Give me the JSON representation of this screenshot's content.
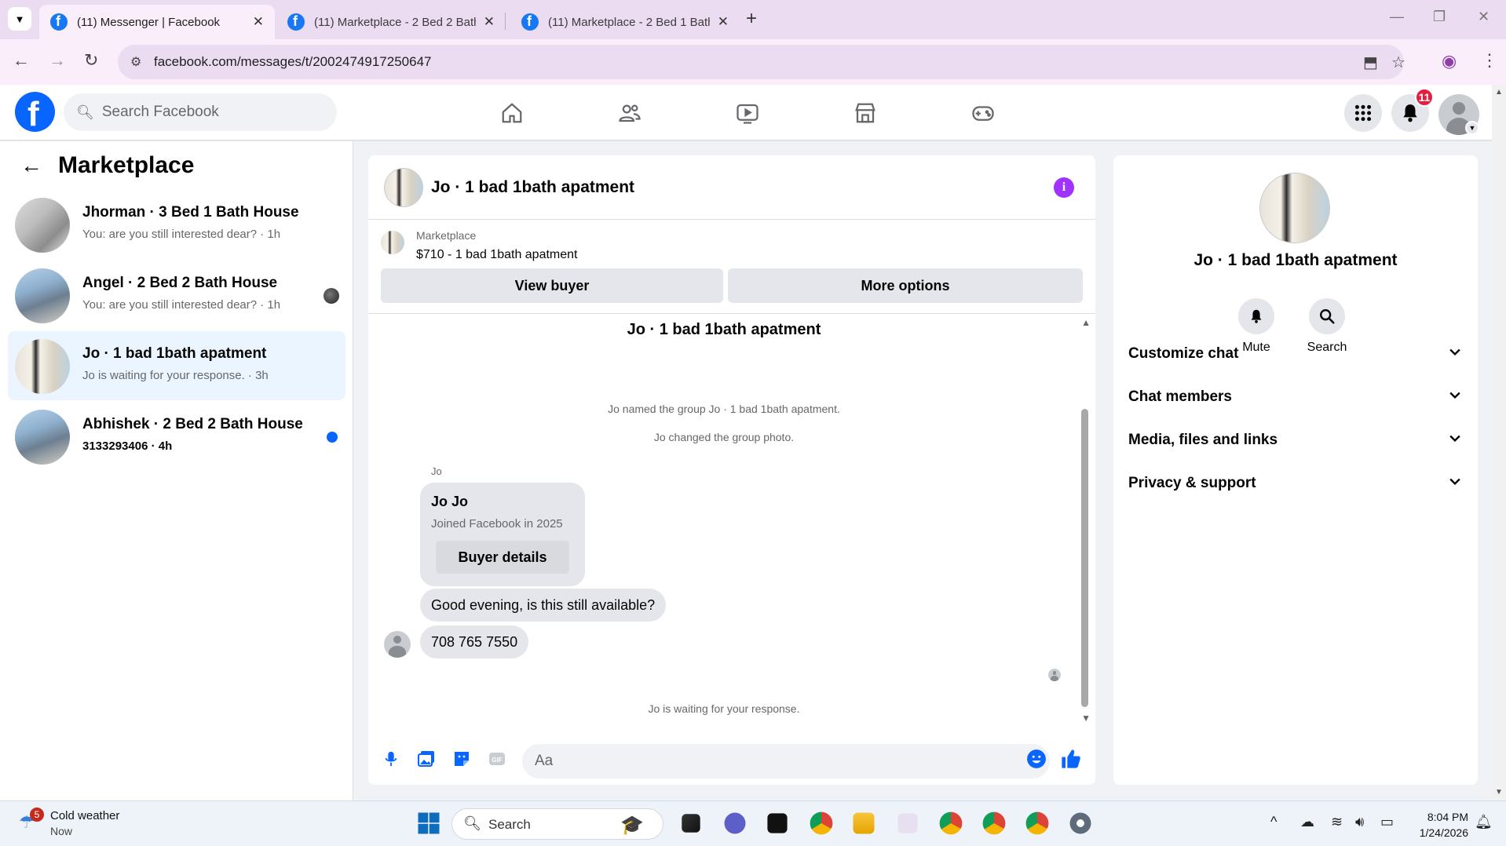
{
  "browser": {
    "tabs": [
      {
        "title": "(11) Messenger | Facebook",
        "active": true
      },
      {
        "title": "(11) Marketplace - 2 Bed 2 Bath",
        "active": false
      },
      {
        "title": "(11) Marketplace - 2 Bed 1 Bath",
        "active": false
      }
    ],
    "url": "facebook.com/messages/t/2002474917250647"
  },
  "fb": {
    "search_placeholder": "Search Facebook",
    "notifications_count": "11"
  },
  "left": {
    "title": "Marketplace",
    "conversations": [
      {
        "name": "Jhorman · 3 Bed 1 Bath House",
        "sub": "You: are you still interested dear? · 1h"
      },
      {
        "name": "Angel · 2 Bed 2 Bath House",
        "sub": "You: are you still interested dear? · 1h"
      },
      {
        "name": "Jo · 1 bad 1bath apatment",
        "sub": "Jo is waiting for your response. · 3h"
      },
      {
        "name": "Abhishek · 2 Bed 2 Bath House",
        "sub": "3133293406 · 4h"
      }
    ]
  },
  "chat": {
    "title": "Jo · 1 bad 1bath apatment",
    "marketplace_label": "Marketplace",
    "listing": "$710 - 1 bad 1bath apatment",
    "view_buyer": "View buyer",
    "more_options": "More options",
    "thread_title": "Jo · 1 bad 1bath apatment",
    "sys1": "Jo named the group Jo · 1 bad 1bath apatment.",
    "sys2": "Jo changed the group photo.",
    "sender": "Jo",
    "card_name": "Jo Jo",
    "card_joined": "Joined Facebook in 2025",
    "buyer_details": "Buyer details",
    "msg1": "Good evening, is this still available?",
    "msg2": "708 765 7550",
    "waiting": "Jo is waiting for your response.",
    "composer_placeholder": "Aa"
  },
  "right": {
    "name": "Jo · 1 bad 1bath apatment",
    "mute": "Mute",
    "search": "Search",
    "sections": [
      "Customize chat",
      "Chat members",
      "Media, files and links",
      "Privacy & support"
    ]
  },
  "taskbar": {
    "weather_badge": "5",
    "weather_title": "Cold weather",
    "weather_sub": "Now",
    "search": "Search",
    "time": "8:04 PM",
    "date": "1/24/2026"
  }
}
